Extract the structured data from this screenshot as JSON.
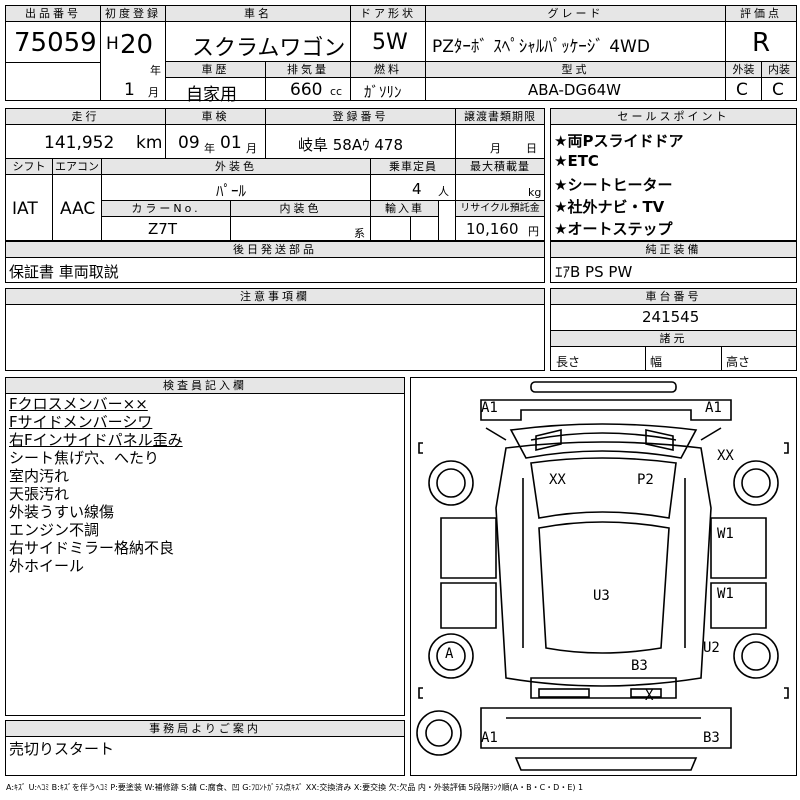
{
  "header": {
    "lot_label": "出品番号",
    "lot_number": "75059",
    "reg_label": "初度登録",
    "reg_era": "H",
    "reg_year": "20",
    "reg_year_unit": "年",
    "reg_month": "1",
    "reg_month_unit": "月",
    "car_name_label": "車名",
    "car_name": "スクラムワゴン",
    "door_label": "ドア形状",
    "door": "5W",
    "grade_label": "グレード",
    "grade": "PZﾀｰﾎﾞ ｽﾍﾟｼｬﾙﾊﾟｯｹｰｼﾞ 4WD",
    "score_label": "評価点",
    "score": "R",
    "history_label": "車歴",
    "history": "自家用",
    "displacement_label": "排気量",
    "displacement": "660",
    "displacement_unit": "cc",
    "fuel_label": "燃料",
    "fuel": "ｶﾞｿﾘﾝ",
    "model_label": "型式",
    "model": "ABA-DG64W",
    "ext_label": "外装",
    "ext_grade": "C",
    "int_label": "内装",
    "int_grade": "C"
  },
  "row2": {
    "mileage_label": "走行",
    "mileage": "141,952",
    "mileage_unit": "km",
    "inspection_label": "車検",
    "inspection_year": "09",
    "inspection_year_unit": "年",
    "inspection_month": "01",
    "inspection_month_unit": "月",
    "plate_label": "登録番号",
    "plate": "岐阜 58Aｳ 478",
    "transfer_label": "譲渡書類期限",
    "transfer_month_unit": "月",
    "transfer_day_unit": "日",
    "shift_label": "シフト",
    "shift": "IAT",
    "ac_label": "エアコン",
    "ac": "AAC",
    "ext_color_label": "外装色",
    "ext_color": "ﾊﾟｰﾙ",
    "capacity_label": "乗車定員",
    "capacity": "4",
    "capacity_unit": "人",
    "max_load_label": "最大積載量",
    "max_load_unit": "kg",
    "color_no_label": "カラーNo.",
    "color_no": "Z7T",
    "int_color_label": "内装色",
    "int_color_suffix": "系",
    "import_label": "輸入車",
    "recycle_label": "リサイクル預託金",
    "recycle": "10,160",
    "recycle_unit": "円"
  },
  "sales_points": {
    "label": "セールスポイント",
    "items": [
      "★両Pスライドドア",
      "★ETC",
      "★シートヒーター",
      "★社外ナビ・TV",
      "★オートステップ"
    ]
  },
  "later_parts": {
    "label": "後日発送部品",
    "value": "保証書 車両取説"
  },
  "genuine_equipment": {
    "label": "純正装備",
    "value": "ｴｱB PS PW"
  },
  "notes": {
    "label": "注意事項欄",
    "value": ""
  },
  "chassis": {
    "label": "車台番号",
    "value": "241545"
  },
  "dimensions": {
    "label": "諸元",
    "length_label": "長さ",
    "width_label": "幅",
    "height_label": "高さ"
  },
  "inspector": {
    "label": "検査員記入欄",
    "lines": [
      "Fクロスメンバー××",
      "Fサイドメンバーシワ",
      "右Fインサイドパネル歪み",
      "シート焦げ穴、へたり",
      "室内汚れ",
      "天張汚れ",
      "外装うすい線傷",
      "エンジン不調",
      "右サイドミラー格納不良",
      "外ホイール"
    ]
  },
  "office": {
    "label": "事務局よりご案内",
    "value": "売切りスタート"
  },
  "diagram_marks": {
    "front_left": "A1",
    "front_right": "A1",
    "left_front_seat": "XX",
    "right_front_seat": "P2",
    "right_front_fender": "XX",
    "right_side_1": "W1",
    "right_side_2": "W1",
    "center": "U3",
    "right_rear": "U2",
    "left_rear": "A",
    "rear_center": "B3",
    "rear_bumper_x": "X",
    "rear_left": "A1",
    "rear_right": "B3"
  },
  "legend": "A:ｷｽﾞ U:ﾍｺﾐ B:ｷｽﾞを伴うﾍｺﾐ P:要塗装 W:補修跡 S:錆 C:腐食、凹 G:ﾌﾛﾝﾄｶﾞﾗｽ点ｷｽﾞ XX:交換済み X:要交換 欠:欠品 内・外装評価 5段階ﾗﾝｸ順(A・B・C・D・E) 1"
}
